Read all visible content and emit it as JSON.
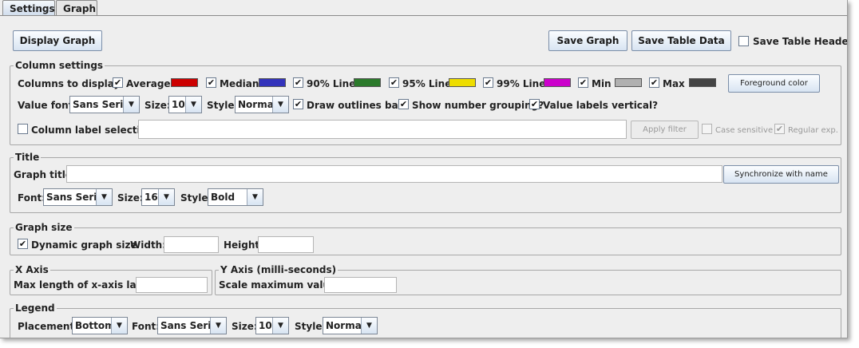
{
  "tabs": [
    {
      "label": "Settings",
      "active": true
    },
    {
      "label": "Graph",
      "active": false
    }
  ],
  "toolbar": {
    "display_graph": "Display Graph",
    "save_graph": "Save Graph",
    "save_table_data": "Save Table Data",
    "save_table_header": "Save Table Header",
    "save_table_header_checked": false
  },
  "column_settings": {
    "title": "Column settings",
    "columns_label": "Columns to display:",
    "columns": [
      {
        "label": "Average",
        "checked": true,
        "color": "#cc0000"
      },
      {
        "label": "Median",
        "checked": true,
        "color": "#3333bb"
      },
      {
        "label": "90% Line",
        "checked": true,
        "color": "#2b7a2b"
      },
      {
        "label": "95% Line",
        "checked": true,
        "color": "#eedd00"
      },
      {
        "label": "99% Line",
        "checked": true,
        "color": "#cc00cc"
      },
      {
        "label": "Min",
        "checked": true,
        "color": "#b0b0b0"
      },
      {
        "label": "Max",
        "checked": true,
        "color": "#444444"
      }
    ],
    "foreground_button": "Foreground color",
    "value_font_label": "Value font:",
    "value_font": "Sans Serif",
    "size_label": "Size:",
    "size": "10",
    "style_label": "Style:",
    "style": "Normal",
    "draw_outlines": "Draw outlines bar?",
    "number_grouping": "Show number grouping?",
    "labels_vertical": "Value labels vertical?",
    "label_selection": "Column label selection:",
    "label_selection_value": "",
    "apply_filter": "Apply filter",
    "case_sensitive": "Case sensitive",
    "regular_exp": "Regular exp."
  },
  "title_section": {
    "title": "Title",
    "graph_title_label": "Graph title:",
    "graph_title_value": "",
    "sync_button": "Synchronize with name",
    "font_label": "Font:",
    "font": "Sans Serif",
    "size_label": "Size:",
    "size": "16",
    "style_label": "Style:",
    "style": "Bold"
  },
  "graph_size": {
    "title": "Graph size",
    "dynamic": "Dynamic graph size",
    "width_label": "Width:",
    "width_value": "",
    "height_label": "Height:",
    "height_value": ""
  },
  "x_axis": {
    "title": "X Axis",
    "max_len_label": "Max length of x-axis label:",
    "max_len_value": ""
  },
  "y_axis": {
    "title": "Y Axis (milli-seconds)",
    "scale_label": "Scale maximum value:",
    "scale_value": ""
  },
  "legend": {
    "title": "Legend",
    "placement_label": "Placement:",
    "placement": "Bottom",
    "font_label": "Font:",
    "font": "Sans Serif",
    "size_label": "Size:",
    "size": "10",
    "style_label": "Style:",
    "style": "Normal"
  }
}
